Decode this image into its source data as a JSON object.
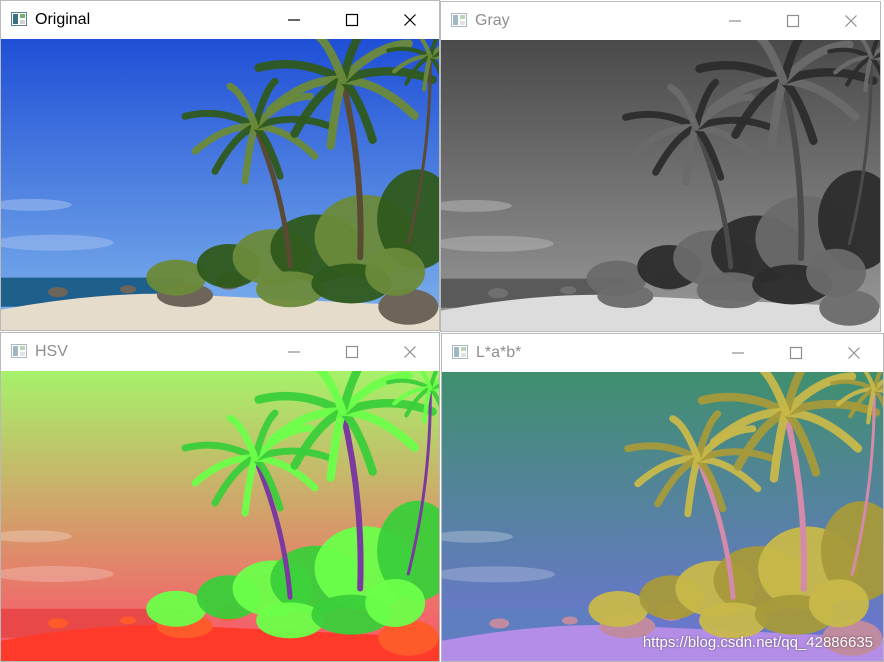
{
  "windows": [
    {
      "id": "original",
      "title": "Original",
      "active": true,
      "buttons": [
        "minimize",
        "maximize",
        "close"
      ],
      "palette": {
        "sky_top": "#1f4fd6",
        "sky_bottom": "#7fb3ec",
        "sea": "#1e5f8c",
        "sand": "#e6dccb",
        "rock": "#6d655a",
        "foliage": "#2f5a1c",
        "foliage_light": "#6b8a3a",
        "trunk": "#5a4a33"
      }
    },
    {
      "id": "gray",
      "title": "Gray",
      "active": false,
      "buttons": [
        "minimize",
        "maximize",
        "close"
      ],
      "palette": {
        "sky_top": "#4a4a4a",
        "sky_bottom": "#9a9a9a",
        "sea": "#5a5a5a",
        "sand": "#dcdcdc",
        "rock": "#707070",
        "foliage": "#2c2c2c",
        "foliage_light": "#6a6a6a",
        "trunk": "#4a4a4a"
      }
    },
    {
      "id": "hsv",
      "title": "HSV",
      "active": false,
      "buttons": [
        "minimize",
        "maximize",
        "close"
      ],
      "palette": {
        "sky_top": "#a6f26a",
        "sky_bottom": "#ff4f6a",
        "sea": "#e84848",
        "sand": "#ff3a2a",
        "rock": "#ff5a2a",
        "foliage": "#3acf3a",
        "foliage_light": "#6cff4a",
        "trunk": "#7a3aa0"
      }
    },
    {
      "id": "lab",
      "title": "L*a*b*",
      "active": false,
      "buttons": [
        "minimize",
        "maximize",
        "close"
      ],
      "palette": {
        "sky_top": "#3f8f6e",
        "sky_bottom": "#6f74d8",
        "sea": "#5f7ec0",
        "sand": "#b48ee6",
        "rock": "#c08aa0",
        "foliage": "#a69a3a",
        "foliage_light": "#c8b84a",
        "trunk": "#d48aa8"
      }
    }
  ],
  "window_icon": "image-window-icon",
  "watermark": "https://blog.csdn.net/qq_42886635"
}
